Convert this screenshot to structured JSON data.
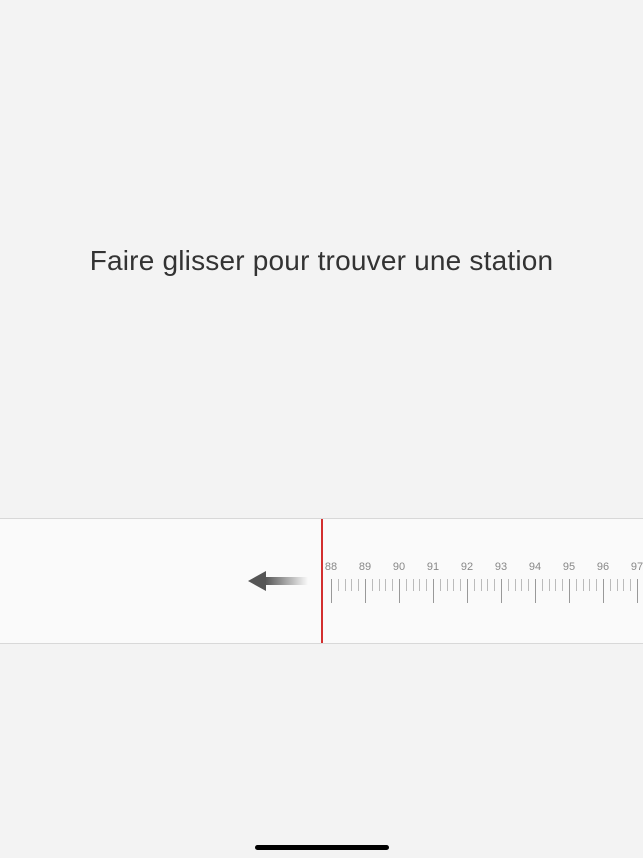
{
  "instruction": "Faire glisser pour trouver une station",
  "tuner": {
    "indicator_color": "#d32f2f",
    "frequencies": [
      88,
      89,
      90,
      91,
      92,
      93,
      94,
      95,
      96,
      97
    ],
    "tick_spacing_px": 34,
    "minor_ticks_per_major": 5
  }
}
